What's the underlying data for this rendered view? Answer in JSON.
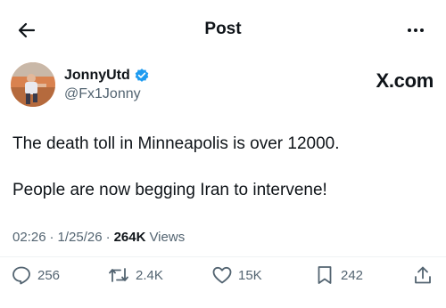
{
  "header": {
    "title": "Post"
  },
  "author": {
    "display_name": "JonnyUtd",
    "handle": "@Fx1Jonny",
    "source": "X.com"
  },
  "post": {
    "lines": [
      "The death toll in Minneapolis is over 12000.",
      "People are now begging Iran to intervene!"
    ],
    "time": "02:26",
    "date": "1/25/26",
    "views_count": "264K",
    "views_label": "Views"
  },
  "actions": {
    "replies": "256",
    "reposts": "2.4K",
    "likes": "15K",
    "bookmarks": "242"
  },
  "colors": {
    "text": "#0f1419",
    "secondary": "#536471",
    "verified": "#1d9bf0"
  },
  "icons": [
    "back-arrow-icon",
    "more-icon",
    "verified-badge-icon",
    "reply-icon",
    "repost-icon",
    "like-icon",
    "bookmark-icon",
    "share-icon"
  ]
}
